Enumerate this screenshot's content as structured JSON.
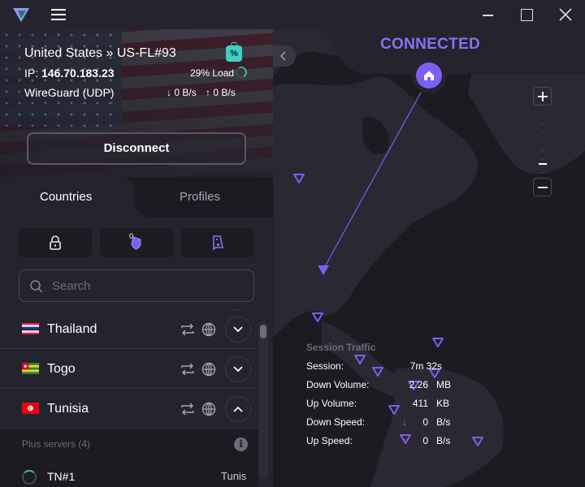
{
  "window": {
    "menu_icon": "hamburger-icon",
    "controls": [
      "minimize",
      "maximize",
      "close"
    ]
  },
  "connection": {
    "server_country": "United States",
    "separator": "»",
    "server_name": "US-FL#93",
    "ip_label": "IP:",
    "ip_address": "146.70.183.23",
    "protocol": "WireGuard (UDP)",
    "load_text": "29% Load",
    "load_percent": 29,
    "download_speed": "0 B/s",
    "upload_speed": "0 B/s",
    "disconnect_label": "Disconnect",
    "status": "CONNECTED"
  },
  "tabs": [
    {
      "label": "Countries",
      "active": true
    },
    {
      "label": "Profiles",
      "active": false
    }
  ],
  "features": [
    {
      "name": "secure-core",
      "icon": "lock-icon"
    },
    {
      "name": "netshield",
      "icon": "shield-icon",
      "badge": "0"
    },
    {
      "name": "kill-switch",
      "icon": "device-icon"
    }
  ],
  "search": {
    "placeholder": "Search",
    "value": ""
  },
  "countries": [
    {
      "name": "Thailand",
      "expanded": false
    },
    {
      "name": "Togo",
      "expanded": false
    },
    {
      "name": "Tunisia",
      "expanded": true
    }
  ],
  "tunisia_servers": {
    "group_title": "Plus servers (4)",
    "servers": [
      {
        "name": "TN#1",
        "city": "Tunis"
      }
    ]
  },
  "map": {
    "zoom_level_fraction": 0.75,
    "accent_color": "#7c5ff2"
  },
  "session_traffic": {
    "title": "Session Traffic",
    "rows": [
      {
        "label": "Session:",
        "value": "7m 32s",
        "unit": ""
      },
      {
        "label": "Down Volume:",
        "value": "2.26",
        "unit": "MB"
      },
      {
        "label": "Up Volume:",
        "value": "411",
        "unit": "KB"
      },
      {
        "label": "Down Speed:",
        "value": "0",
        "unit": "B/s"
      },
      {
        "label": "Up Speed:",
        "value": "0",
        "unit": "B/s"
      }
    ]
  }
}
